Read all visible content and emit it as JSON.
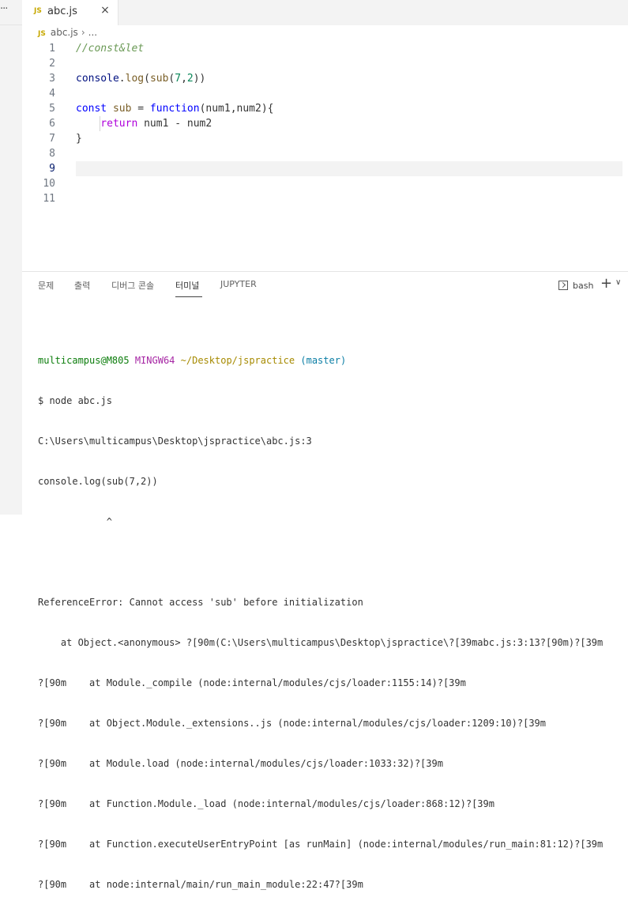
{
  "window": {
    "more_icon": "ellipsis-icon"
  },
  "tab": {
    "badge": "JS",
    "label": "abc.js",
    "close": "×"
  },
  "breadcrumb": {
    "badge": "JS",
    "file": "abc.js",
    "sep": "›",
    "more": "..."
  },
  "editor": {
    "line_numbers": [
      "1",
      "2",
      "3",
      "4",
      "5",
      "6",
      "7",
      "8",
      "9",
      "10",
      "11"
    ],
    "active_line": "9",
    "lines": {
      "l1": "//const&let",
      "l3_a": "console",
      "l3_b": ".",
      "l3_c": "log",
      "l3_d": "(",
      "l3_e": "sub",
      "l3_f": "(",
      "l3_g": "7",
      "l3_h": ",",
      "l3_i": "2",
      "l3_j": "))",
      "l5_a": "const",
      "l5_b": " sub ",
      "l5_c": "=",
      "l5_d": " function",
      "l5_e": "(num1,num2){",
      "l6_a": "    return",
      "l6_b": " num1 ",
      "l6_c": "-",
      "l6_d": " num2",
      "l7": "}"
    }
  },
  "panel": {
    "tabs": [
      "문제",
      "출력",
      "디버그 콘솔",
      "터미널",
      "JUPYTER"
    ],
    "active_tab": "터미널",
    "terminal_label": "bash",
    "add_label": "+",
    "chevron": "∨"
  },
  "terminal": {
    "prompt_user": "multicampus@M805",
    "prompt_env": "MINGW64",
    "prompt_path": "~/Desktop/jspractice",
    "prompt_branch": "(master)",
    "lines": [
      "$ node abc.js",
      "C:\\Users\\multicampus\\Desktop\\jspractice\\abc.js:3",
      "console.log(sub(7,2))",
      "            ^",
      "",
      "ReferenceError: Cannot access 'sub' before initialization",
      "    at Object.<anonymous> ?[90m(C:\\Users\\multicampus\\Desktop\\jspractice\\?[39mabc.js:3:13?[90m)?[39m",
      "?[90m    at Module._compile (node:internal/modules/cjs/loader:1155:14)?[39m",
      "?[90m    at Object.Module._extensions..js (node:internal/modules/cjs/loader:1209:10)?[39m",
      "?[90m    at Module.load (node:internal/modules/cjs/loader:1033:32)?[39m",
      "?[90m    at Function.Module._load (node:internal/modules/cjs/loader:868:12)?[39m",
      "?[90m    at Function.executeUserEntryPoint [as runMain] (node:internal/modules/run_main:81:12)?[39m",
      "?[90m    at node:internal/main/run_main_module:22:47?[39m"
    ]
  }
}
